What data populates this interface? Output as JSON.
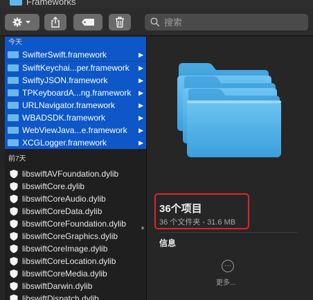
{
  "window": {
    "title": "Frameworks"
  },
  "toolbar": {
    "search_placeholder": "搜索"
  },
  "list": {
    "section_today": "今天",
    "today_items": [
      {
        "label": "SwifterSwift.framework"
      },
      {
        "label": "SwiftKeychai...per.framework"
      },
      {
        "label": "SwiftyJSON.framework"
      },
      {
        "label": "TPKeyboardA...ng.framework"
      },
      {
        "label": "URLNavigator.framework"
      },
      {
        "label": "WBADSDK.framework"
      },
      {
        "label": "WebViewJava...e.framework"
      },
      {
        "label": "XCGLogger.framework"
      }
    ],
    "section_prev7": "前7天",
    "prev_items": [
      {
        "label": "libswiftAVFoundation.dylib"
      },
      {
        "label": "libswiftCore.dylib"
      },
      {
        "label": "libswiftCoreAudio.dylib"
      },
      {
        "label": "libswiftCoreData.dylib"
      },
      {
        "label": "libswiftCoreFoundation.dylib"
      },
      {
        "label": "libswiftCoreGraphics.dylib"
      },
      {
        "label": "libswiftCoreImage.dylib"
      },
      {
        "label": "libswiftCoreLocation.dylib"
      },
      {
        "label": "libswiftCoreMedia.dylib"
      },
      {
        "label": "libswiftDarwin.dylib"
      },
      {
        "label": "libswiftDispatch.dylib"
      }
    ]
  },
  "preview": {
    "item_count_title": "36个项目",
    "item_detail": "36 个文件夹 - 31.6 MB",
    "info_heading": "信息",
    "more_label": "更多..."
  },
  "colors": {
    "selection": "#0d57c9",
    "folder": "#5fb7ee",
    "highlight_box": "#e02626"
  }
}
